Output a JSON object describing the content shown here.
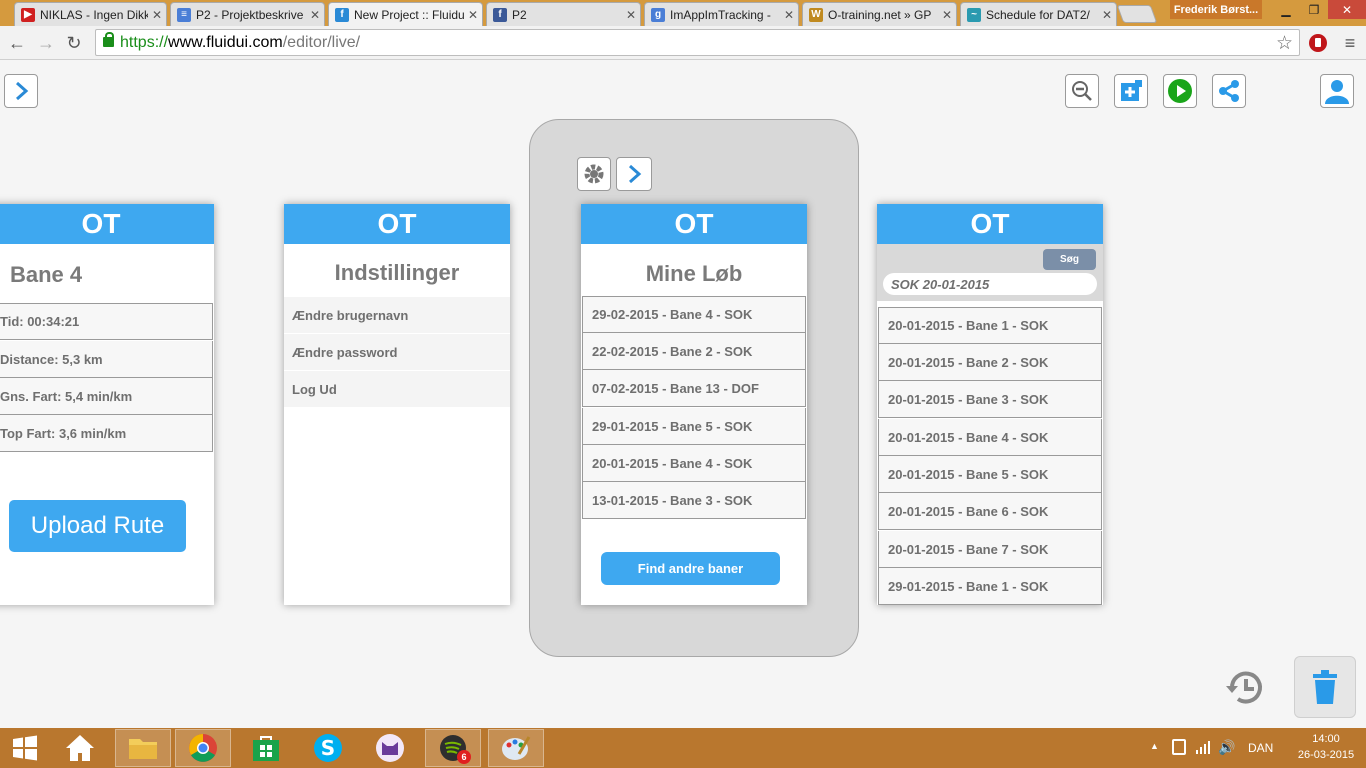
{
  "browser": {
    "tabs": [
      {
        "title": "NIKLAS - Ingen Dikk",
        "icon": "youtube-icon",
        "color": "#d02020"
      },
      {
        "title": "P2 - Projektbeskrive",
        "icon": "docs-icon",
        "color": "#4a7ed6"
      },
      {
        "title": "New Project :: Fluidu",
        "icon": "fluidui-icon",
        "color": "#2a8ad6"
      },
      {
        "title": "P2",
        "icon": "facebook-icon",
        "color": "#3b5998"
      },
      {
        "title": "ImAppImTracking -",
        "icon": "google-icon",
        "color": "#4a7ed6"
      },
      {
        "title": "O-training.net » GP",
        "icon": "otraining-icon",
        "color": "#c08a20"
      },
      {
        "title": "Schedule for DAT2/",
        "icon": "schedule-icon",
        "color": "#2a9ab0"
      }
    ],
    "user": "Frederik Børst...",
    "url": {
      "scheme": "https://",
      "host": "www.fluidui.com",
      "path": "/editor/live/"
    }
  },
  "screens": {
    "bane": {
      "header": "OT",
      "title": "Bane 4",
      "stats": [
        "Tid: 00:34:21",
        "Distance: 5,3 km",
        "Gns. Fart: 5,4 min/km",
        "Top Fart: 3,6 min/km"
      ],
      "upload_label": "Upload Rute"
    },
    "settings": {
      "header": "OT",
      "title": "Indstillinger",
      "items": [
        "Ændre brugernavn",
        "Ændre password",
        "Log Ud"
      ]
    },
    "minelob": {
      "header": "OT",
      "title": "Mine Løb",
      "items": [
        "29-02-2015 - Bane 4 - SOK",
        "22-02-2015 - Bane 2 - SOK",
        "07-02-2015 - Bane 13 - DOF",
        "29-01-2015 - Bane 5 - SOK",
        "20-01-2015 - Bane 4 - SOK",
        "13-01-2015 - Bane 3 - SOK"
      ],
      "find_label": "Find andre baner"
    },
    "search": {
      "header": "OT",
      "search_button": "Søg",
      "query": "SOK 20-01-2015",
      "results": [
        "20-01-2015 - Bane 1 - SOK",
        "20-01-2015 - Bane 2 - SOK",
        "20-01-2015 - Bane 3 - SOK",
        "20-01-2015 - Bane 4 - SOK",
        "20-01-2015 - Bane 5 - SOK",
        "20-01-2015 - Bane 6 - SOK",
        "20-01-2015 - Bane 7 - SOK",
        "29-01-2015 - Bane 1 - SOK"
      ]
    }
  },
  "taskbar": {
    "language": "DAN",
    "time": "14:00",
    "date": "26-03-2015",
    "spotify_badge": "6"
  },
  "colors": {
    "accent": "#3ea8f0",
    "taskbar": "#b9772e",
    "play": "#1aa51a"
  }
}
